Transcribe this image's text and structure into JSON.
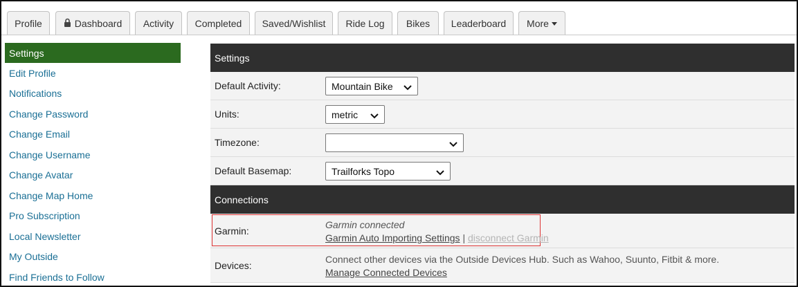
{
  "tabs": [
    {
      "label": "Profile"
    },
    {
      "label": "Dashboard",
      "icon": "lock-icon"
    },
    {
      "label": "Activity"
    },
    {
      "label": "Completed"
    },
    {
      "label": "Saved/Wishlist"
    },
    {
      "label": "Ride Log"
    },
    {
      "label": "Bikes"
    },
    {
      "label": "Leaderboard"
    },
    {
      "label": "More",
      "icon": "caret-down-icon"
    }
  ],
  "sidebar": {
    "active": "Settings",
    "items": [
      "Edit Profile",
      "Notifications",
      "Change Password",
      "Change Email",
      "Change Username",
      "Change Avatar",
      "Change Map Home",
      "Pro Subscription",
      "Local Newsletter",
      "My Outside",
      "Find Friends to Follow"
    ]
  },
  "settings": {
    "heading": "Settings",
    "default_activity": {
      "label": "Default Activity:",
      "value": "Mountain Bike"
    },
    "units": {
      "label": "Units:",
      "value": "metric"
    },
    "timezone": {
      "label": "Timezone:",
      "value": ""
    },
    "basemap": {
      "label": "Default Basemap:",
      "value": "Trailforks Topo"
    }
  },
  "connections": {
    "heading": "Connections",
    "garmin": {
      "label": "Garmin:",
      "status": "Garmin connected",
      "settings_link": "Garmin Auto Importing Settings",
      "separator": "|",
      "disconnect_link": "disconnect Garmin"
    },
    "devices": {
      "label": "Devices:",
      "description": "Connect other devices via the Outside Devices Hub. Such as Wahoo, Suunto, Fitbit & more.",
      "manage_link": "Manage Connected Devices"
    }
  },
  "colors": {
    "active_green": "#2b6a1f",
    "link_blue": "#1a6f95",
    "header_dark": "#2f2f2f",
    "highlight_red": "#dd3333"
  }
}
